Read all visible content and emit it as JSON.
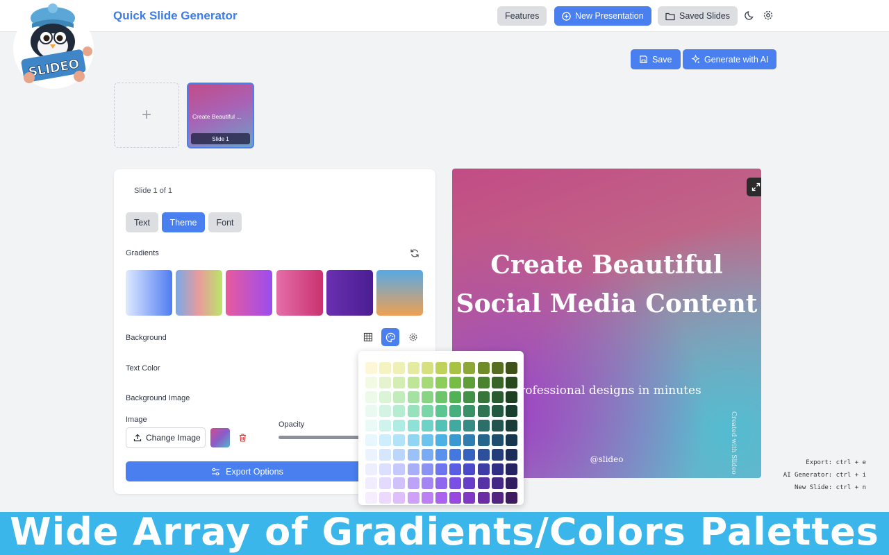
{
  "header": {
    "title": "Quick Slide Generator",
    "nav": {
      "features": "Features",
      "new_presentation": "New Presentation",
      "saved_slides": "Saved Slides"
    }
  },
  "logo": {
    "text": "SLIDEO"
  },
  "toolbar": {
    "save": "Save",
    "generate_ai": "Generate with AI"
  },
  "slides": {
    "add_symbol": "+",
    "thumb_title": "Create Beautiful ...",
    "thumb_label": "Slide 1"
  },
  "editor": {
    "slide_count": "Slide 1 of 1",
    "tabs": [
      "Text",
      "Theme",
      "Font"
    ],
    "active_tab": "Theme",
    "gradients_label": "Gradients",
    "gradients": [
      [
        "#dfe9ff",
        "#4f7cf0"
      ],
      [
        "#78a9e8",
        "#e99b9b",
        "#b9e66a"
      ],
      [
        "#e85a9c",
        "#9b4df0"
      ],
      [
        "#e46ea9",
        "#c9326f"
      ],
      [
        "#6a2fb0",
        "#4a1e92"
      ],
      [
        "#57a9e6",
        "#efa052"
      ]
    ],
    "background_label": "Background",
    "text_color_label": "Text Color",
    "background_image_label": "Background Image",
    "image_label": "Image",
    "change_image": "Change Image",
    "opacity_label": "Opacity",
    "export_options": "Export Options"
  },
  "preview": {
    "title": "Create Beautiful Social Media Content",
    "subtitle": "professional designs in minutes",
    "handle": "@slideo",
    "watermark": "Created with Slideo"
  },
  "palette": {
    "rows": [
      [
        "#fdf6d8",
        "#f6f3c2",
        "#eef0b5",
        "#e4eba0",
        "#d6e07e",
        "#bfd35b",
        "#a8c244",
        "#8da836",
        "#6f8b2a",
        "#566d22",
        "#3f5019"
      ],
      [
        "#f3fae4",
        "#e5f4cf",
        "#d3edb2",
        "#bfe596",
        "#a6da77",
        "#8dcd5a",
        "#76bd45",
        "#5f9f38",
        "#4b8230",
        "#386526",
        "#28491d"
      ],
      [
        "#eefae9",
        "#daf4d5",
        "#c2ecbc",
        "#a5e1a0",
        "#87d483",
        "#6cc669",
        "#52b154",
        "#439247",
        "#37753b",
        "#2a5a2f",
        "#1d3f22"
      ],
      [
        "#ebfaf1",
        "#d3f4e2",
        "#b6ecd0",
        "#97e2bc",
        "#78d6a7",
        "#5bc690",
        "#45b07c",
        "#3a9167",
        "#2f7453",
        "#245941",
        "#183f2e"
      ],
      [
        "#e9faf7",
        "#cff4ee",
        "#b0ece3",
        "#8ee1d6",
        "#6dd3c7",
        "#52c2b7",
        "#40aaa0",
        "#368b84",
        "#2c6f6a",
        "#225552",
        "#173c3a"
      ],
      [
        "#e8f7fd",
        "#cfeefb",
        "#b2e3f8",
        "#90d5f4",
        "#6cc4ee",
        "#4cb2e6",
        "#3999d0",
        "#307eaf",
        "#28658d",
        "#1f4d6d",
        "#16364d"
      ],
      [
        "#ebf3fe",
        "#d5e6fd",
        "#bbd6fb",
        "#9bc2f8",
        "#78abf4",
        "#5892ee",
        "#4278df",
        "#3763c0",
        "#2d509c",
        "#233e7a",
        "#1a2d59"
      ],
      [
        "#eeeffe",
        "#dcdffd",
        "#c5c9fb",
        "#a8aff8",
        "#8a92f4",
        "#6e75ee",
        "#5a5ee3",
        "#4b4bc9",
        "#3e3da6",
        "#312f84",
        "#252361"
      ],
      [
        "#f2edfe",
        "#e4dafd",
        "#d1c1fb",
        "#bca3f8",
        "#a584f4",
        "#8f66ee",
        "#7b4fe3",
        "#683ec9",
        "#5632a6",
        "#442784",
        "#331d61"
      ],
      [
        "#f6edfe",
        "#ecd9fd",
        "#dfbffb",
        "#cfa0f8",
        "#bd80f4",
        "#ab62ee",
        "#984ae0",
        "#8139c4",
        "#6a2ea2",
        "#542481",
        "#3e1a5f"
      ]
    ]
  },
  "shortcuts": [
    "Export: ctrl + e",
    "AI Generator: ctrl + i",
    "New Slide: ctrl + n"
  ],
  "caption": "Wide Array of Gradients/Colors Palettes"
}
